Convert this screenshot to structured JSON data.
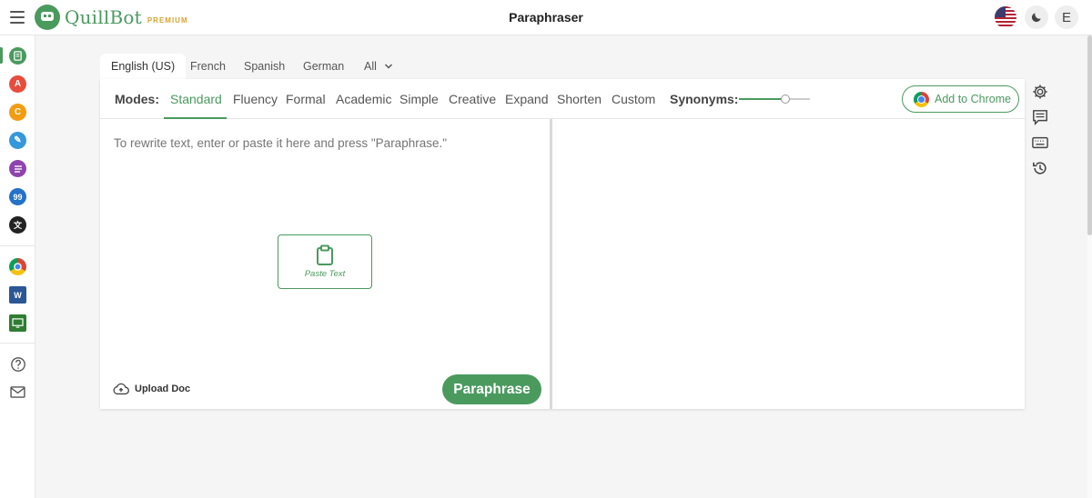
{
  "header": {
    "logo_text": "QuillBot",
    "premium_label": "PREMIUM",
    "title": "Paraphraser",
    "avatar_initial": "E"
  },
  "sidebar": {
    "icons": [
      {
        "name": "paraphraser-icon",
        "color": "#4a9a5e",
        "glyph": "▤"
      },
      {
        "name": "grammar-checker-icon",
        "color": "#e74c3c",
        "glyph": "A"
      },
      {
        "name": "plagiarism-checker-icon",
        "color": "#f39c12",
        "glyph": "C"
      },
      {
        "name": "co-writer-icon",
        "color": "#3498db",
        "glyph": "✎"
      },
      {
        "name": "summarizer-icon",
        "color": "#8e44ad",
        "glyph": "≡"
      },
      {
        "name": "citation-generator-icon",
        "color": "#2471c8",
        "glyph": "99"
      },
      {
        "name": "translator-icon",
        "color": "#222222",
        "glyph": "文"
      }
    ]
  },
  "languages": {
    "tabs": [
      "English (US)",
      "French",
      "Spanish",
      "German"
    ],
    "all_label": "All",
    "active": "English (US)"
  },
  "modes": {
    "label": "Modes:",
    "items": [
      "Standard",
      "Fluency",
      "Formal",
      "Academic",
      "Simple",
      "Creative",
      "Expand",
      "Shorten",
      "Custom"
    ],
    "active": "Standard"
  },
  "synonyms": {
    "label": "Synonyms:",
    "level": 0.65
  },
  "chrome_button": "Add to Chrome",
  "editor": {
    "placeholder": "To rewrite text, enter or paste it here and press \"Paraphrase.\"",
    "paste_label": "Paste Text",
    "upload_label": "Upload Doc",
    "paraphrase_label": "Paraphrase"
  },
  "colors": {
    "accent": "#4a9a5e",
    "premium": "#d8a432"
  }
}
